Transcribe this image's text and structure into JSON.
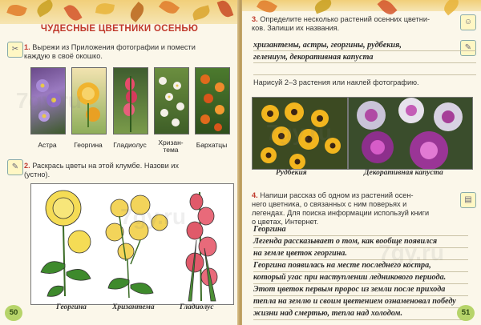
{
  "left": {
    "title": "ЧУДЕСНЫЕ ЦВЕТНИКИ ОСЕНЬЮ",
    "task1": {
      "num": "1.",
      "line1": "Вырежи из Приложения фотографии и помести",
      "line2": "каждую в своё окошко."
    },
    "photo_captions": [
      "Астра",
      "Георгина",
      "Гладиолус",
      "Хризан-\nтема",
      "Бархатцы"
    ],
    "task2": {
      "num": "2.",
      "line1": "Раскрась цветы на этой клумбе. Назови их",
      "line2": "(устно)."
    },
    "drawing_captions": [
      "Георгина",
      "Хризантема",
      "Гладиолус"
    ],
    "page_number": "50"
  },
  "right": {
    "task3": {
      "num": "3.",
      "line1": "Определите несколько растений осенних цветни-",
      "line2": "ков. Запиши их названия."
    },
    "answer3": [
      "хризантемы, астры, георгины, рудбекия,",
      "гелениум, декоративная капуста"
    ],
    "draw_prompt": "Нарисуй 2–3 растения или наклей фотографию.",
    "photo_captions": [
      "Рудбекия",
      "Декоративная капуста"
    ],
    "task4": {
      "num": "4.",
      "lines": [
        "Напиши рассказ об одном из растений осен-",
        "него цветника, о связанных с ним поверьях и",
        "легендах. Для поиска информации используй книги",
        "о цветах, Интернет."
      ]
    },
    "answer4": [
      "Георгина",
      "Легенда рассказывает о том, как вообще появился",
      "на земле цветок георгина.",
      "Георгина появилась на месте последнего костра,",
      "который угас при наступлении ледникового периода.",
      "Этот цветок первым пророс из земли после прихода",
      "тепла на землю и своим цветением ознаменовал победу",
      "жизни над смертью, тепла над холодом."
    ],
    "page_number": "51"
  },
  "watermark": "7gy.ru",
  "colors": {
    "accent": "#c0392b",
    "page": "#fbf7ea",
    "pagenum": "#b6d46a"
  }
}
